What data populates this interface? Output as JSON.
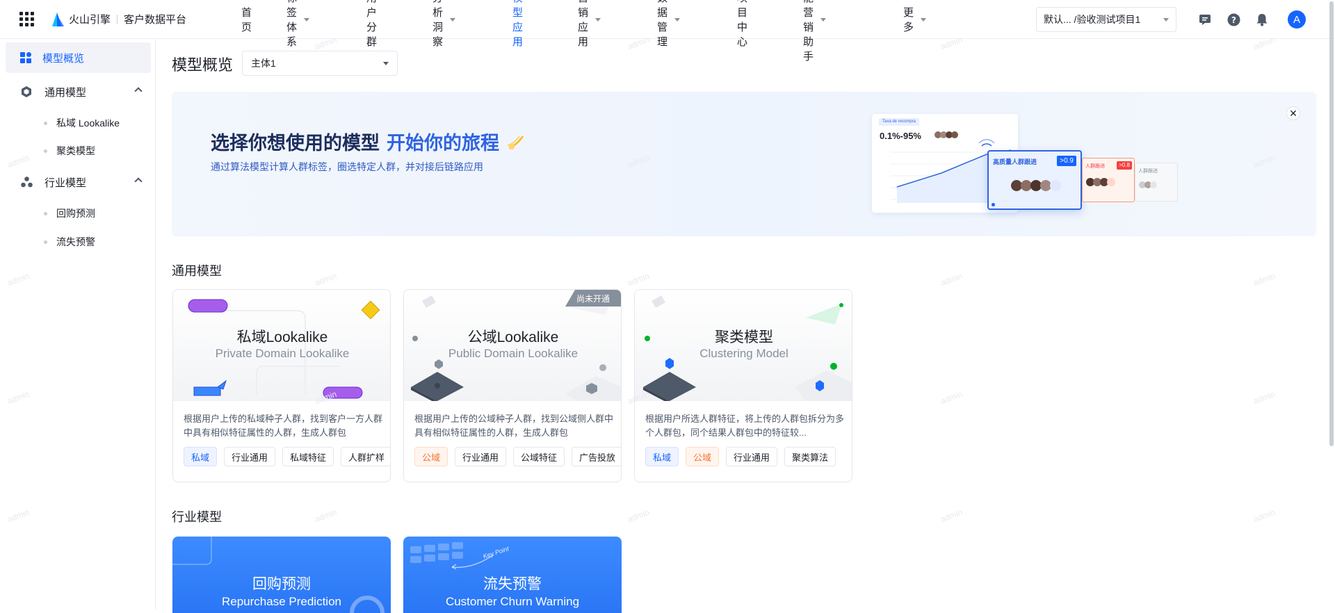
{
  "header": {
    "brand": "火山引擎",
    "product": "客户数据平台",
    "nav": [
      {
        "label": "首页",
        "dropdown": false,
        "active": false
      },
      {
        "label": "标签体系",
        "dropdown": true,
        "active": false
      },
      {
        "label": "用户分群",
        "dropdown": false,
        "active": false
      },
      {
        "label": "分析洞察",
        "dropdown": true,
        "active": false
      },
      {
        "label": "模型应用",
        "dropdown": false,
        "active": true
      },
      {
        "label": "营销应用",
        "dropdown": true,
        "active": false
      },
      {
        "label": "数据管理",
        "dropdown": true,
        "active": false
      },
      {
        "label": "项目中心",
        "dropdown": false,
        "active": false
      },
      {
        "label": "智能营销助手",
        "dropdown": true,
        "active": false
      },
      {
        "label": "更多",
        "dropdown": true,
        "active": false
      }
    ],
    "project": "默认... /验收测试项目1",
    "avatar": "A",
    "accent": "#1664ff"
  },
  "sidebar": {
    "active": "模型概览",
    "groups": [
      {
        "label": "通用模型",
        "items": [
          "私域 Lookalike",
          "聚类模型"
        ]
      },
      {
        "label": "行业模型",
        "items": [
          "回购预测",
          "流失预警"
        ]
      }
    ]
  },
  "main": {
    "title": "模型概览",
    "subject": "主体1",
    "banner": {
      "title": "选择你想使用的模型",
      "title_highlight": "开始你的旅程",
      "subtitle": "通过算法模型计算人群标签，圈选特定人群，并对接后链路应用",
      "illustration": {
        "range": "0.1%-95%",
        "tag": "Taxa de recompra",
        "card_high": "高质量人群跟进",
        "badge_high": ">0.9",
        "card_mid": "人群跟进",
        "badge_mid": ">0.8",
        "card_low": "人群跟进"
      }
    },
    "general_section": "通用模型",
    "industry_section": "行业模型",
    "general_cards": [
      {
        "name": "私域Lookalike",
        "en": "Private Domain Lookalike",
        "desc": "根据用户上传的私域种子人群，找到客户一方人群中具有相似特征属性的人群，生成人群包",
        "badge": "",
        "tags": [
          {
            "text": "私域",
            "style": "blue"
          },
          {
            "text": "行业通用",
            "style": ""
          },
          {
            "text": "私域特征",
            "style": ""
          },
          {
            "text": "人群扩样",
            "style": ""
          }
        ]
      },
      {
        "name": "公域Lookalike",
        "en": "Public Domain Lookalike",
        "desc": "根据用户上传的公域种子人群，找到公域侧人群中具有相似特征属性的人群，生成人群包",
        "badge": "尚未开通",
        "tags": [
          {
            "text": "公域",
            "style": "orange"
          },
          {
            "text": "行业通用",
            "style": ""
          },
          {
            "text": "公域特征",
            "style": ""
          },
          {
            "text": "广告投放",
            "style": ""
          }
        ]
      },
      {
        "name": "聚类模型",
        "en": "Clustering Model",
        "desc": "根据用户所选人群特征，将上传的人群包拆分为多个人群包，同个结果人群包中的特征较...",
        "badge": "",
        "tags": [
          {
            "text": "私域",
            "style": "blue"
          },
          {
            "text": "公域",
            "style": "orange"
          },
          {
            "text": "行业通用",
            "style": ""
          },
          {
            "text": "聚类算法",
            "style": ""
          }
        ]
      }
    ],
    "industry_cards": [
      {
        "name": "回购预测",
        "en": "Repurchase Prediction"
      },
      {
        "name": "流失预警",
        "en": "Customer Churn Warning",
        "note": "Key Point"
      }
    ],
    "watermark": "admin"
  }
}
